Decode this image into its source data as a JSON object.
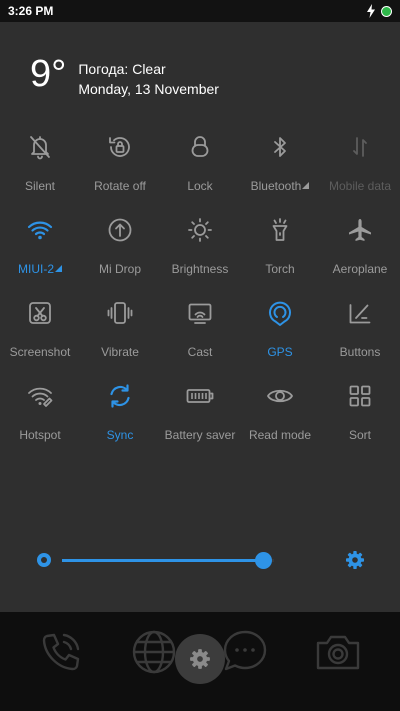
{
  "status_bar": {
    "time": "3:26 PM",
    "icons": [
      "charging-bolt-icon",
      "battery-dot-icon"
    ],
    "battery_color": "#2fb84a"
  },
  "weather": {
    "temperature": "9°",
    "condition": "Погода: Clear",
    "date": "Monday, 13 November"
  },
  "accent_color": "#2e93e6",
  "toggles": [
    {
      "label": "Silent",
      "icon": "bell-off-icon",
      "state": "off"
    },
    {
      "label": "Rotate off",
      "icon": "rotation-lock-icon",
      "state": "off"
    },
    {
      "label": "Lock",
      "icon": "lock-icon",
      "state": "off"
    },
    {
      "label": "Bluetooth",
      "icon": "bluetooth-icon",
      "state": "off",
      "has_submenu": true
    },
    {
      "label": "Mobile data",
      "icon": "mobile-data-icon",
      "state": "disabled"
    },
    {
      "label": "MIUI-2",
      "icon": "wifi-icon",
      "state": "on",
      "has_submenu": true
    },
    {
      "label": "Mi Drop",
      "icon": "mi-drop-icon",
      "state": "off"
    },
    {
      "label": "Brightness",
      "icon": "sun-icon",
      "state": "off"
    },
    {
      "label": "Torch",
      "icon": "torch-icon",
      "state": "off"
    },
    {
      "label": "Aeroplane",
      "icon": "airplane-icon",
      "state": "off"
    },
    {
      "label": "Screenshot",
      "icon": "screenshot-icon",
      "state": "off"
    },
    {
      "label": "Vibrate",
      "icon": "vibrate-icon",
      "state": "off"
    },
    {
      "label": "Cast",
      "icon": "cast-icon",
      "state": "off"
    },
    {
      "label": "GPS",
      "icon": "gps-icon",
      "state": "on"
    },
    {
      "label": "Buttons",
      "icon": "buttons-icon",
      "state": "off"
    },
    {
      "label": "Hotspot",
      "icon": "hotspot-icon",
      "state": "off"
    },
    {
      "label": "Sync",
      "icon": "sync-icon",
      "state": "on"
    },
    {
      "label": "Battery saver",
      "icon": "battery-saver-icon",
      "state": "off"
    },
    {
      "label": "Read mode",
      "icon": "eye-icon",
      "state": "off"
    },
    {
      "label": "Sort",
      "icon": "grid-icon",
      "state": "off"
    }
  ],
  "brightness": {
    "level": 0.95,
    "low_icon": "brightness-low-icon",
    "auto_icon": "brightness-auto-gear-icon"
  },
  "dock": {
    "icons": [
      "phone-icon",
      "browser-globe-icon",
      "settings-gear-icon",
      "messages-icon",
      "camera-icon"
    ]
  }
}
